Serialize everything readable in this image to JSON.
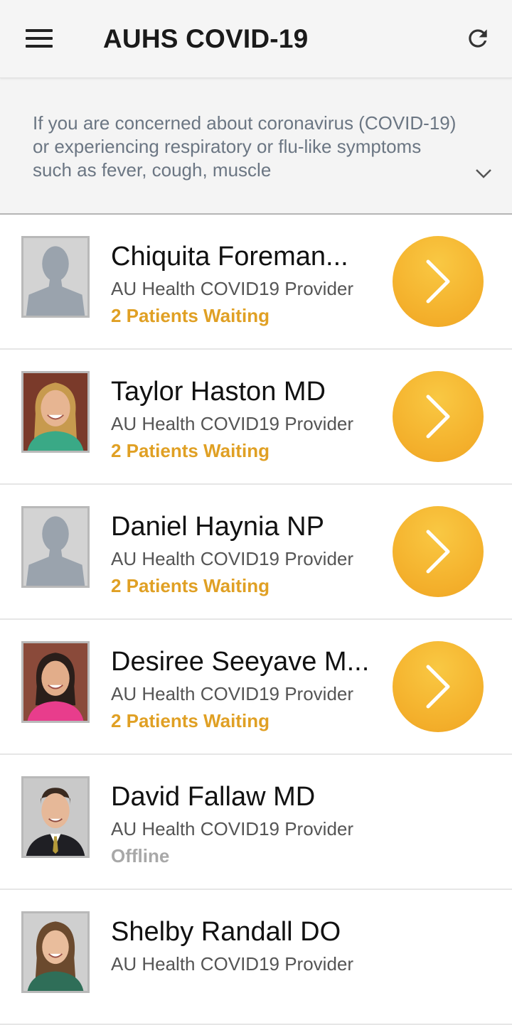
{
  "app_bar": {
    "title": "AUHS COVID-19",
    "menu_icon": "hamburger-menu-icon",
    "refresh_icon": "refresh-icon"
  },
  "banner": {
    "text": "If you are concerned about coronavirus (COVID-19) or experiencing respiratory or flu-like symptoms such as fever, cough, muscle",
    "chevron_icon": "chevron-down-icon"
  },
  "colors": {
    "accent": "#f5b530",
    "waiting_text": "#e0a024",
    "offline_text": "#a8a8a8",
    "banner_text": "#6b7683"
  },
  "providers": [
    {
      "name": "Chiquita Foreman...",
      "role": "AU Health COVID19 Provider",
      "status": "2 Patients Waiting",
      "avatar": "placeholder-silhouette",
      "online": true
    },
    {
      "name": "Taylor Haston MD",
      "role": "AU Health COVID19 Provider",
      "status": "2 Patients Waiting",
      "avatar": "photo-woman-blonde",
      "online": true
    },
    {
      "name": "Daniel Haynia NP",
      "role": "AU Health COVID19 Provider",
      "status": "2 Patients Waiting",
      "avatar": "placeholder-silhouette",
      "online": true
    },
    {
      "name": "Desiree Seeyave M...",
      "role": "AU Health COVID19 Provider",
      "status": "2 Patients Waiting",
      "avatar": "photo-woman-dark-hair",
      "online": true
    },
    {
      "name": "David Fallaw MD",
      "role": "AU Health COVID19 Provider",
      "status": "Offline",
      "avatar": "photo-man-suit",
      "online": false
    },
    {
      "name": "Shelby Randall DO",
      "role": "AU Health COVID19 Provider",
      "status": "",
      "avatar": "photo-woman-brown-hair",
      "online": false
    }
  ]
}
